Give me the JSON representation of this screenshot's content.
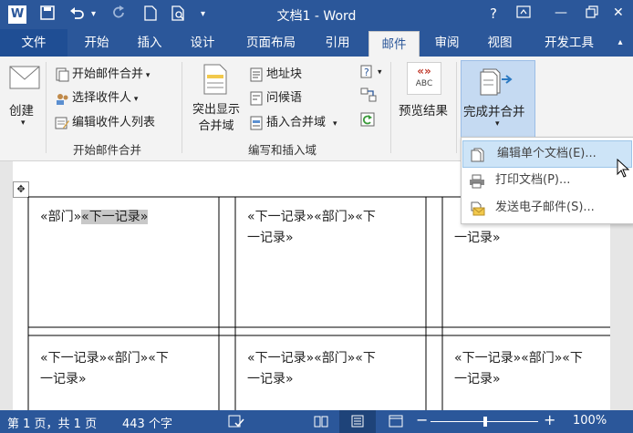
{
  "app": {
    "title": "文档1 - Word",
    "logo": "W"
  },
  "titlebar_icons": {
    "help": "?",
    "minimize": "—",
    "close": "✕"
  },
  "tabs": [
    {
      "label": "文件"
    },
    {
      "label": "开始"
    },
    {
      "label": "插入"
    },
    {
      "label": "设计"
    },
    {
      "label": "页面布局"
    },
    {
      "label": "引用"
    },
    {
      "label": "邮件"
    },
    {
      "label": "审阅"
    },
    {
      "label": "视图"
    },
    {
      "label": "开发工具"
    }
  ],
  "ribbon": {
    "create": {
      "label": "创建"
    },
    "start_merge": {
      "start": "开始邮件合并",
      "select": "选择收件人",
      "edit_list": "编辑收件人列表",
      "group": "开始邮件合并"
    },
    "write_insert": {
      "highlight_line1": "突出显示",
      "highlight_line2": "合并域",
      "address": "地址块",
      "greeting": "问候语",
      "insert_field": "插入合并域",
      "group": "编写和插入域"
    },
    "preview": {
      "label": "预览结果",
      "abc": "ABC",
      "chevrons": "«»"
    },
    "finish": {
      "label": "完成并合并"
    }
  },
  "dropdown": {
    "items": [
      {
        "label": "编辑单个文档(E)..."
      },
      {
        "label": "打印文档(P)..."
      },
      {
        "label": "发送电子邮件(S)..."
      }
    ]
  },
  "document": {
    "move_handle": "✥",
    "cell1_a": "«部门»",
    "cell1_b": "«下一记录»",
    "cell2_l1": "«下一记录»«部门»«下",
    "cell2_l2": "一记录»",
    "cell3_l2": "一记录»",
    "row2_l1": "«下一记录»«部门»«下",
    "row2_l2": "一记录»"
  },
  "status": {
    "page": "第 1 页，共 1 页",
    "words": "443 个字",
    "zoom": "100%",
    "minus": "−",
    "plus": "+"
  }
}
